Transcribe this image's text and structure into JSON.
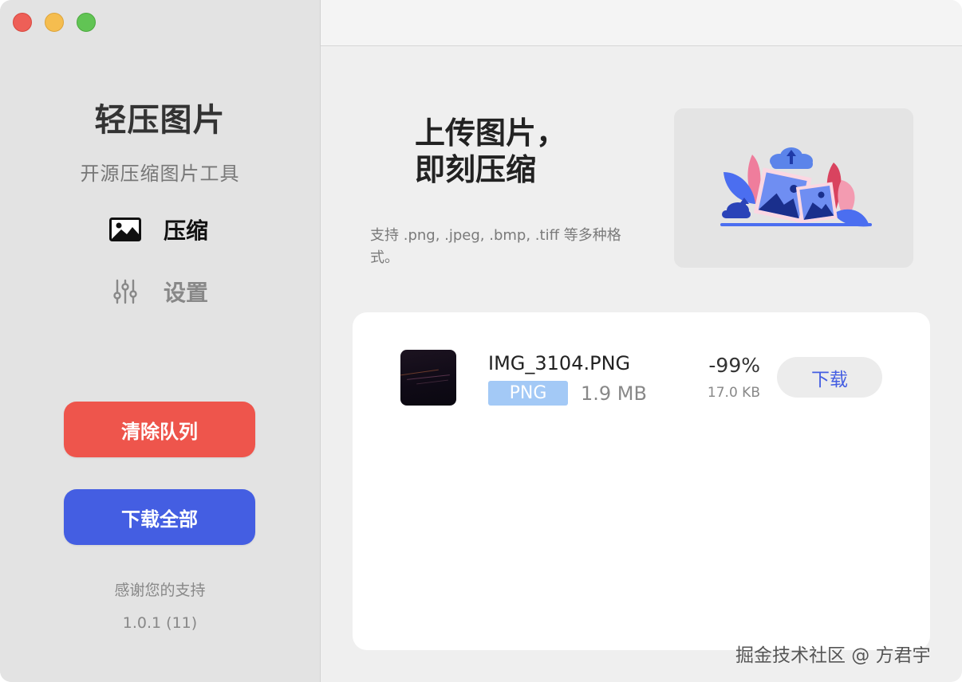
{
  "sidebar": {
    "app_title": "轻压图片",
    "app_subtitle": "开源压缩图片工具",
    "nav": [
      {
        "label": "压缩",
        "icon": "image-icon",
        "active": true
      },
      {
        "label": "设置",
        "icon": "sliders-icon",
        "active": false
      }
    ],
    "clear_queue_label": "清除队列",
    "download_all_label": "下载全部",
    "thanks_text": "感谢您的支持",
    "version_text": "1.0.1 (11)"
  },
  "upload": {
    "heading": "上传图片，\n即刻压缩",
    "description": "支持 .png, .jpeg, .bmp, .tiff 等多种格式。",
    "illustration_icon": "upload-photos-illustration"
  },
  "queue": {
    "items": [
      {
        "file_name": "IMG_3104.PNG",
        "file_type": "PNG",
        "original_size": "1.9 MB",
        "ratio": "-99%",
        "compressed_size": "17.0 KB",
        "download_label": "下载"
      }
    ]
  },
  "watermark": "掘金技术社区 @ 方君宇",
  "colors": {
    "danger": "#ee554c",
    "primary": "#445ee2",
    "badge": "#a3c9f6",
    "sidebar_bg": "#e3e3e3",
    "content_bg": "#efefef"
  }
}
